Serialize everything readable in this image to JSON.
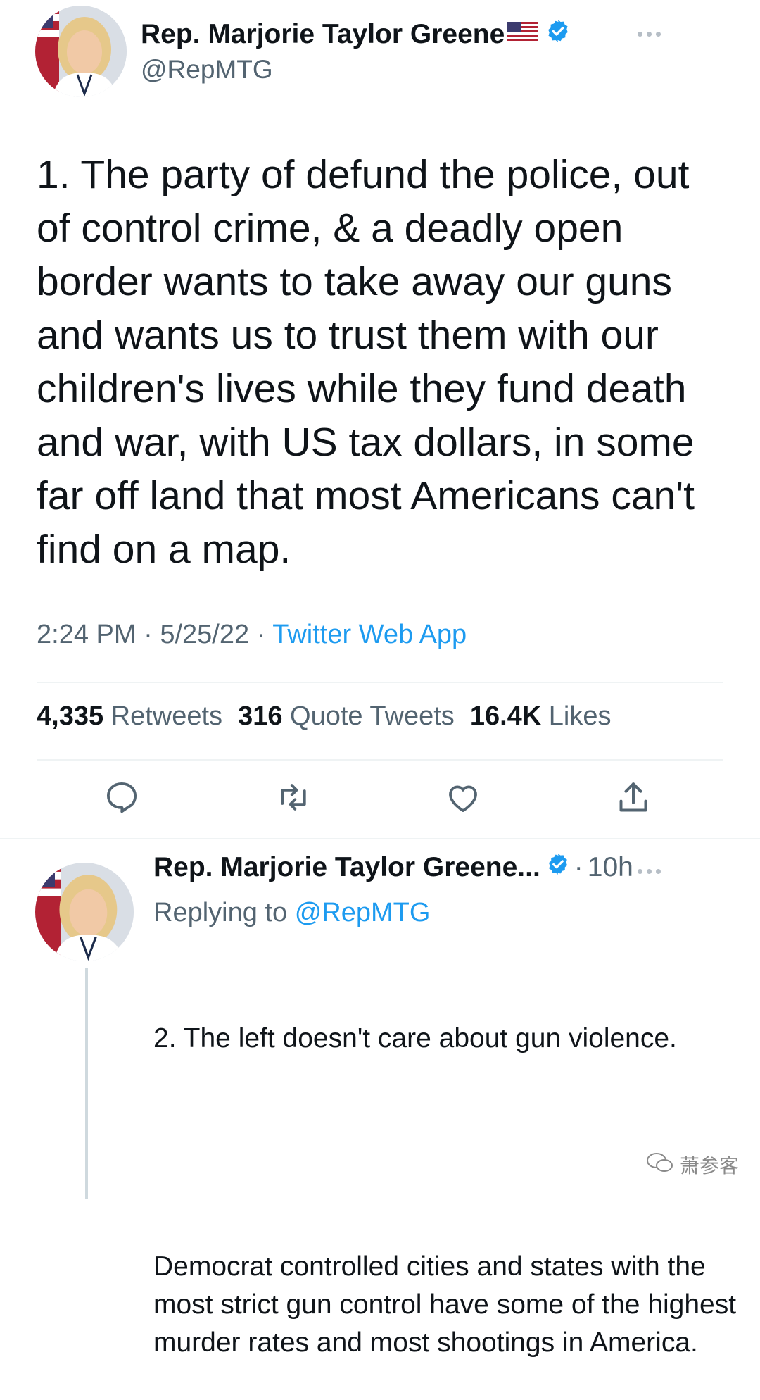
{
  "tweet": {
    "author_name": "Rep. Marjorie Taylor Greene",
    "author_handle": "@RepMTG",
    "text": "1. The party of defund the police, out of control crime, & a deadly open border wants to take away our guns and wants us to trust them with our children's lives while they fund death and war, with US tax dollars, in some far off land that most Americans can't find on a map.",
    "time": "2:24 PM",
    "date": "5/25/22",
    "source": "Twitter Web App",
    "stats": {
      "retweets_count": "4,335",
      "retweets_label": "Retweets",
      "quotes_count": "316",
      "quotes_label": "Quote Tweets",
      "likes_count": "16.4K",
      "likes_label": "Likes"
    },
    "icons": [
      "reply-icon",
      "retweet-icon",
      "like-icon",
      "share-icon"
    ]
  },
  "reply": {
    "author_name": "Rep. Marjorie Taylor Greene...",
    "time": "10h",
    "replying_prefix": "Replying to",
    "replying_to": "@RepMTG",
    "text_p1": "2. The left doesn't care about gun violence.",
    "text_p2": "Democrat controlled cities and states with the most strict gun control have some of the highest murder rates and most shootings in America."
  },
  "watermark": {
    "text": "萧参客"
  },
  "colors": {
    "accent": "#1d9bf0",
    "secondary_text": "#536471",
    "divider": "#eff3f4"
  }
}
